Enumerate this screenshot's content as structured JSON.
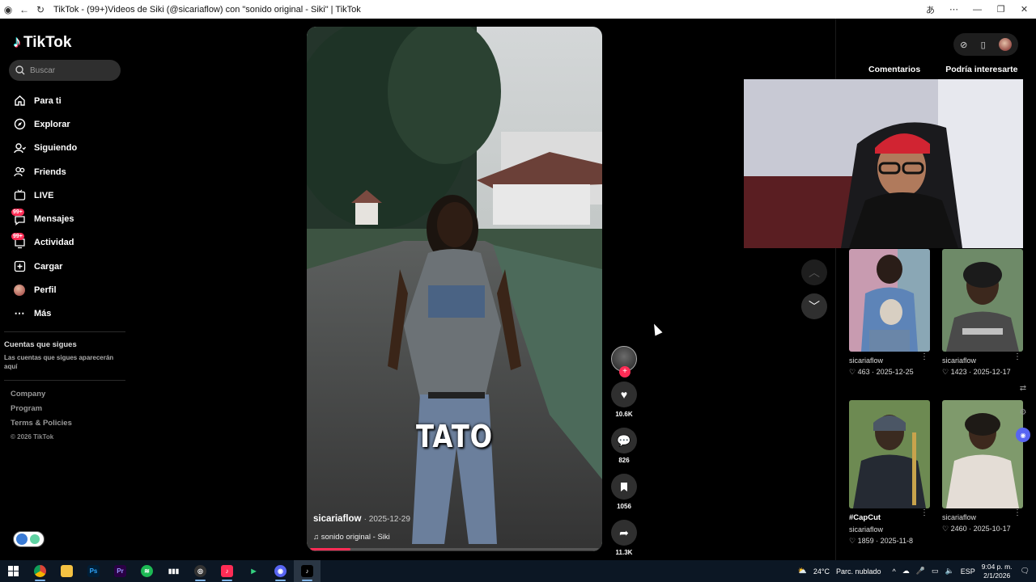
{
  "window": {
    "title": "TikTok - (99+)Videos de Siki (@sicariaflow) con \"sonido original - Siki\" | TikTok"
  },
  "sidebar": {
    "logo": "TikTok",
    "search_placeholder": "Buscar",
    "items": [
      {
        "label": "Para ti",
        "icon": "home-icon"
      },
      {
        "label": "Explorar",
        "icon": "compass-icon"
      },
      {
        "label": "Siguiendo",
        "icon": "user-follow-icon"
      },
      {
        "label": "Friends",
        "icon": "friends-icon"
      },
      {
        "label": "LIVE",
        "icon": "live-icon"
      },
      {
        "label": "Mensajes",
        "icon": "messages-icon",
        "badge": "99+"
      },
      {
        "label": "Actividad",
        "icon": "activity-icon",
        "badge": "99+"
      },
      {
        "label": "Cargar",
        "icon": "upload-icon"
      },
      {
        "label": "Perfil",
        "icon": "profile-avatar-icon"
      },
      {
        "label": "Más",
        "icon": "more-icon"
      }
    ],
    "following_title": "Cuentas que sigues",
    "following_desc": "Las cuentas que sigues aparecerán aquí",
    "footer": [
      "Company",
      "Program",
      "Terms & Policies"
    ],
    "copyright": "© 2026 TikTok"
  },
  "video": {
    "overlay_text": "TATO",
    "username": "sicariaflow",
    "date": "· 2025-12-29",
    "sound": "sonido original - Siki",
    "progress": 0.14
  },
  "actions": {
    "likes": "10.6K",
    "comments": "826",
    "saves": "1056",
    "shares": "11.3K"
  },
  "right_panel": {
    "tabs": [
      "Comentarios",
      "Podría interesarte"
    ],
    "cards": [
      {
        "tag": "",
        "user": "sicariaflow",
        "likes": "463",
        "date": "2025-12-25"
      },
      {
        "tag": "",
        "user": "sicariaflow",
        "likes": "1423",
        "date": "2025-12-17"
      },
      {
        "tag": "#CapCut",
        "user": "sicariaflow",
        "likes": "1859",
        "date": "2025-11-8"
      },
      {
        "tag": "",
        "user": "sicariaflow",
        "likes": "2460",
        "date": "2025-10-17"
      }
    ]
  },
  "taskbar": {
    "weather": "24°C",
    "weather_desc": "Parc. nublado",
    "lang": "ESP",
    "time": "9:04 p. m.",
    "date": "2/1/2026"
  },
  "colors": {
    "accent": "#fe2c55",
    "background": "#000000"
  }
}
